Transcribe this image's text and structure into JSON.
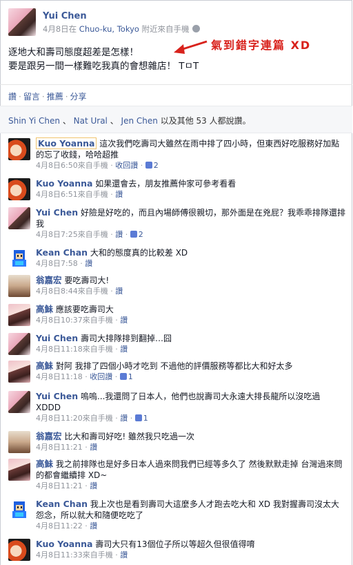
{
  "post": {
    "author": "Yui Chen",
    "meta_date_prefix": "4月8日在 ",
    "meta_location": "Chuo-ku, Tokyo",
    "meta_source": " 附近來自手機",
    "body_line1": "逐地大和壽司態度超差是怎樣！",
    "body_line2": "要是跟另一間一樣難吃我真的會想雜店！ TㅁT",
    "annotation": "氣到錯字連篇 XD",
    "annotation_color": "#d8221c"
  },
  "actions": {
    "like": "讚",
    "comment": "留言",
    "share_push": "推薦",
    "share": "分享",
    "sep": "·"
  },
  "likes": {
    "n1": "Shin Yi Chen",
    "sep1": " 、 ",
    "n2": "Nat Ural",
    "sep2": " 、 ",
    "n3": "Jen Chen",
    "rest": " 以及其他 53 人都說讚。"
  },
  "comments": [
    {
      "author": "Kuo Yoanna",
      "text": "這次我們吃壽司大雖然在雨中排了四小時，但東西好吃服務好加點的忘了收錢，哈哈超推",
      "time": "4月8日6:50",
      "source": "來自手機",
      "like_action": "收回讚",
      "likes": "2",
      "avatar": "kuo"
    },
    {
      "author": "Kuo Yoanna",
      "text": "如果還會去，朋友推薦仲家可參考看看",
      "time": "4月8日6:51",
      "source": "來自手機",
      "like_action": "讚",
      "likes": "",
      "avatar": "kuo"
    },
    {
      "author": "Yui Chen",
      "text": "好險是好吃的，而且內場師傅很親切，那外面是在兇屁？我乖乖排隊還排我",
      "time": "4月8日7:25",
      "source": "來自手機",
      "like_action": "讚",
      "likes": "2",
      "avatar": "yui"
    },
    {
      "author": "Kean Chan",
      "text": "大和的態度真的比較差 XD",
      "time": "4月8日7:58",
      "source": "",
      "like_action": "讚",
      "likes": "",
      "avatar": "kean"
    },
    {
      "author": "翁嘉宏",
      "text": "要吃壽司大!",
      "time": "4月8日8:44",
      "source": "來自手機",
      "like_action": "讚",
      "likes": "",
      "avatar": "weng"
    },
    {
      "author": "高鮇",
      "text": "應該要吃壽司大",
      "time": "4月8日10:37",
      "source": "來自手機",
      "like_action": "讚",
      "likes": "",
      "avatar": "gao"
    },
    {
      "author": "Yui Chen",
      "text": "壽司大排隊排到翻掉…囧",
      "time": "4月8日11:18",
      "source": "來自手機",
      "like_action": "讚",
      "likes": "",
      "avatar": "yui"
    },
    {
      "author": "高鮇",
      "text": "對阿 我排了四個小時才吃到 不過他的評價服務等都比大和好太多",
      "time": "4月8日11:18",
      "source": "",
      "like_action": "收回讚",
      "likes": "1",
      "avatar": "gao"
    },
    {
      "author": "Yui Chen",
      "text": "嗚嗚...我還問了日本人，他們也說壽司大永遠大排長龍所以沒吃過 XDDD",
      "time": "4月8日11:20",
      "source": "來自手機",
      "like_action": "讚",
      "likes": "1",
      "avatar": "yui"
    },
    {
      "author": "翁嘉宏",
      "text": "比大和壽司好吃! 雖然我只吃過一次",
      "time": "4月8日11:21",
      "source": "",
      "like_action": "讚",
      "likes": "",
      "avatar": "weng"
    },
    {
      "author": "高鮇",
      "text": "我之前排隊也是好多日本人過來問我們已經等多久了 然後默默走掉 台灣過來問的都會繼續排 XD~",
      "time": "4月8日11:21",
      "source": "",
      "like_action": "讚",
      "likes": "",
      "avatar": "gao"
    },
    {
      "author": "Kean Chan",
      "text": "我上次也是看到壽司大這麼多人才跑去吃大和 XD 我對握壽司沒太大怨念，所以就大和隨便吃吃了",
      "time": "4月8日11:22",
      "source": "",
      "like_action": "讚",
      "likes": "",
      "avatar": "kean"
    },
    {
      "author": "Kuo Yoanna",
      "text": "壽司大只有13個位子所以等超久但很值得唷",
      "time": "4月8日11:33",
      "source": "來自手機",
      "like_action": "讚",
      "likes": "",
      "avatar": "kuo"
    }
  ]
}
